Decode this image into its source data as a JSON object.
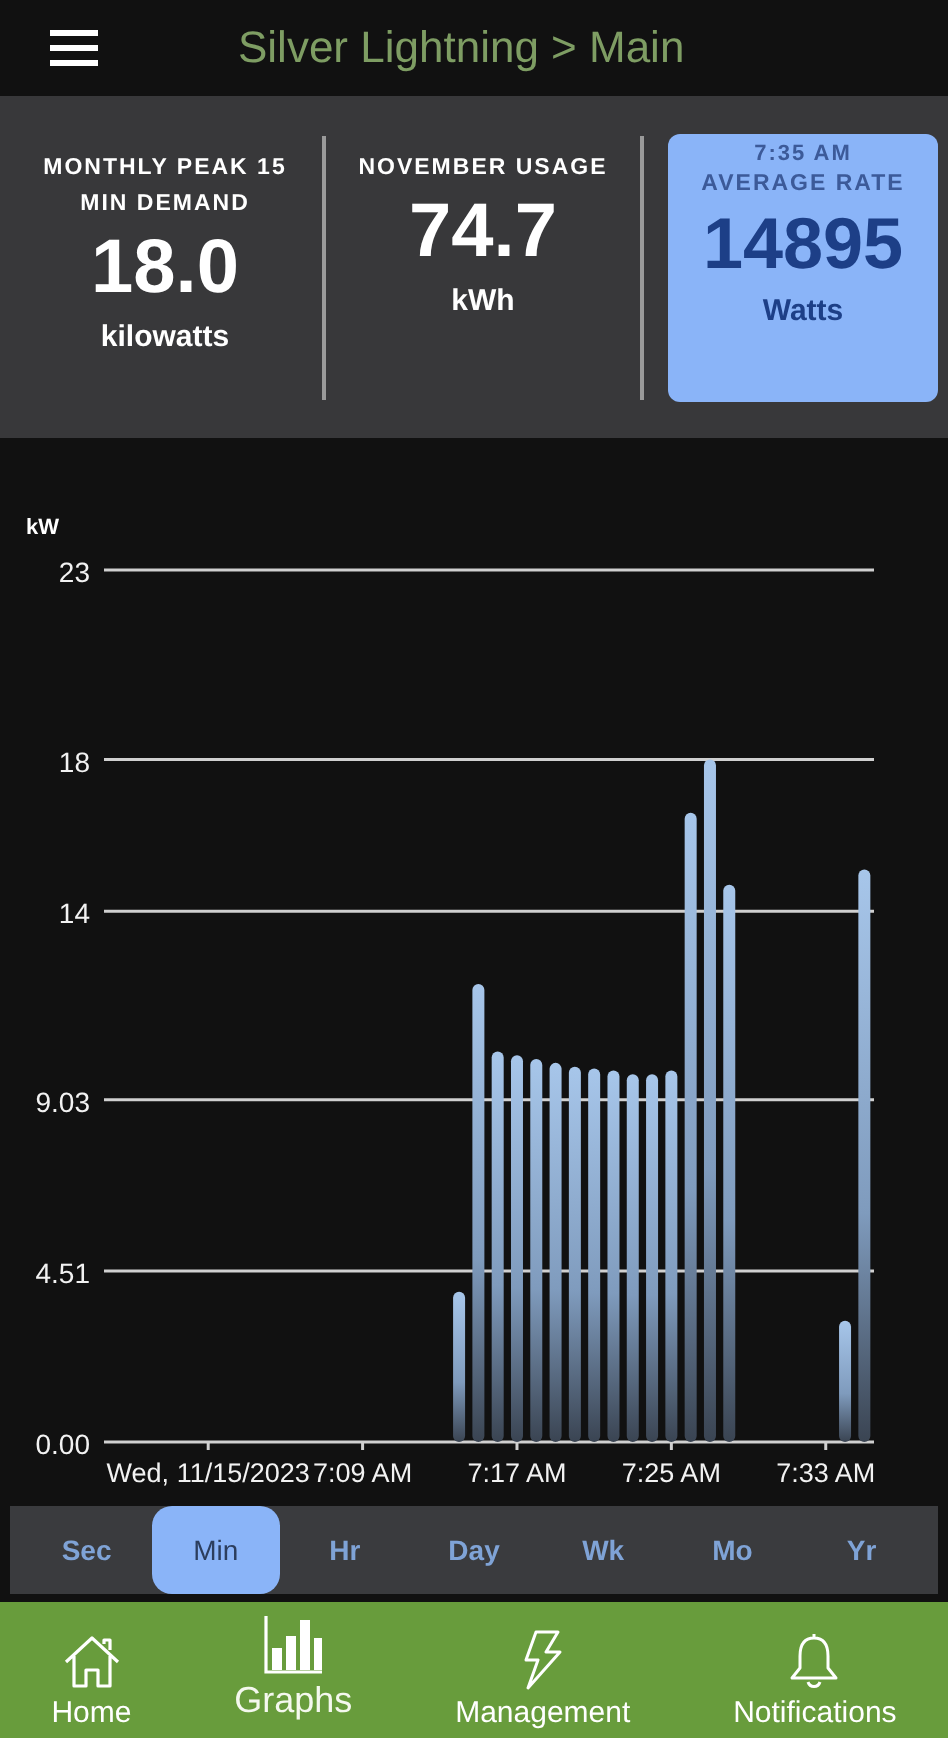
{
  "header": {
    "title": "Silver Lightning > Main"
  },
  "stats": [
    {
      "label": "MONTHLY PEAK 15 MIN DEMAND",
      "value": "18.0",
      "unit": "kilowatts",
      "highlighted": false
    },
    {
      "label": "NOVEMBER USAGE",
      "value": "74.7",
      "unit": "kWh",
      "highlighted": false
    },
    {
      "time": "7:35 AM",
      "label": "AVERAGE RATE",
      "value": "14895",
      "unit": "Watts",
      "highlighted": true
    }
  ],
  "chart": {
    "chart_data": {
      "type": "bar",
      "ylabel": "kW",
      "ylim": [
        0,
        23
      ],
      "categories": [
        null,
        "Wed, 11/15/2023",
        null,
        null,
        null,
        null,
        null,
        null,
        null,
        "7:09 AM",
        null,
        null,
        null,
        null,
        null,
        null,
        null,
        "7:17 AM",
        null,
        null,
        null,
        null,
        null,
        null,
        null,
        "7:25 AM",
        null,
        null,
        null,
        null,
        null,
        null,
        null,
        "7:33 AM",
        null,
        null
      ],
      "values": [
        null,
        null,
        null,
        null,
        null,
        null,
        null,
        null,
        null,
        null,
        null,
        null,
        null,
        null,
        3.96,
        12.08,
        10.3,
        10.2,
        10.1,
        10.0,
        9.9,
        9.85,
        9.8,
        9.7,
        9.7,
        9.8,
        16.6,
        18.0,
        14.7,
        null,
        null,
        null,
        null,
        null,
        3.2,
        15.1
      ],
      "yticks": [
        {
          "value": 0,
          "label": "0.00"
        },
        {
          "value": 4.51,
          "label": "4.51"
        },
        {
          "value": 9.03,
          "label": "9.03"
        },
        {
          "value": 14,
          "label": "14"
        },
        {
          "value": 18,
          "label": "18"
        },
        {
          "value": 23,
          "label": "23"
        }
      ],
      "grid": true
    }
  },
  "ranges": [
    {
      "label": "Sec",
      "selected": false
    },
    {
      "label": "Min",
      "selected": true
    },
    {
      "label": "Hr",
      "selected": false
    },
    {
      "label": "Day",
      "selected": false
    },
    {
      "label": "Wk",
      "selected": false
    },
    {
      "label": "Mo",
      "selected": false
    },
    {
      "label": "Yr",
      "selected": false
    }
  ],
  "nav": [
    {
      "kind": "home",
      "label": "Home",
      "selected": false
    },
    {
      "kind": "graphs",
      "label": "Graphs",
      "selected": true
    },
    {
      "kind": "bolt",
      "label": "Management",
      "selected": false
    },
    {
      "kind": "bell",
      "label": "Notifications",
      "selected": false
    }
  ]
}
